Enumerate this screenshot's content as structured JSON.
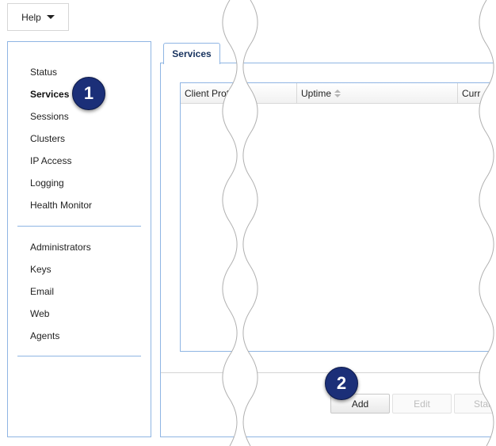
{
  "help_menu": {
    "label": "Help",
    "icon": "caret-down-icon"
  },
  "sidebar": {
    "group1": [
      {
        "label": "Status",
        "active": false
      },
      {
        "label": "Services",
        "active": true
      },
      {
        "label": "Sessions",
        "active": false
      },
      {
        "label": "Clusters",
        "active": false
      },
      {
        "label": "IP Access",
        "active": false
      },
      {
        "label": "Logging",
        "active": false
      },
      {
        "label": "Health Monitor",
        "active": false
      }
    ],
    "group2": [
      {
        "label": "Administrators"
      },
      {
        "label": "Keys"
      },
      {
        "label": "Email"
      },
      {
        "label": "Web"
      },
      {
        "label": "Agents"
      }
    ]
  },
  "callouts": {
    "one": "1",
    "two": "2"
  },
  "tab": {
    "label": "Services"
  },
  "grid": {
    "columns": [
      {
        "label": "Client Prot",
        "sortable": false
      },
      {
        "label": "Uptime",
        "sortable": true
      },
      {
        "label": "Curr",
        "sortable": false
      }
    ],
    "rows": []
  },
  "toolbar": {
    "add_label": "Add",
    "edit_label": "Edit",
    "start_label": "Star"
  },
  "colors": {
    "border_accent": "#8fb5e3",
    "callout_bg": "#1b2f78",
    "tab_text": "#17325e"
  }
}
